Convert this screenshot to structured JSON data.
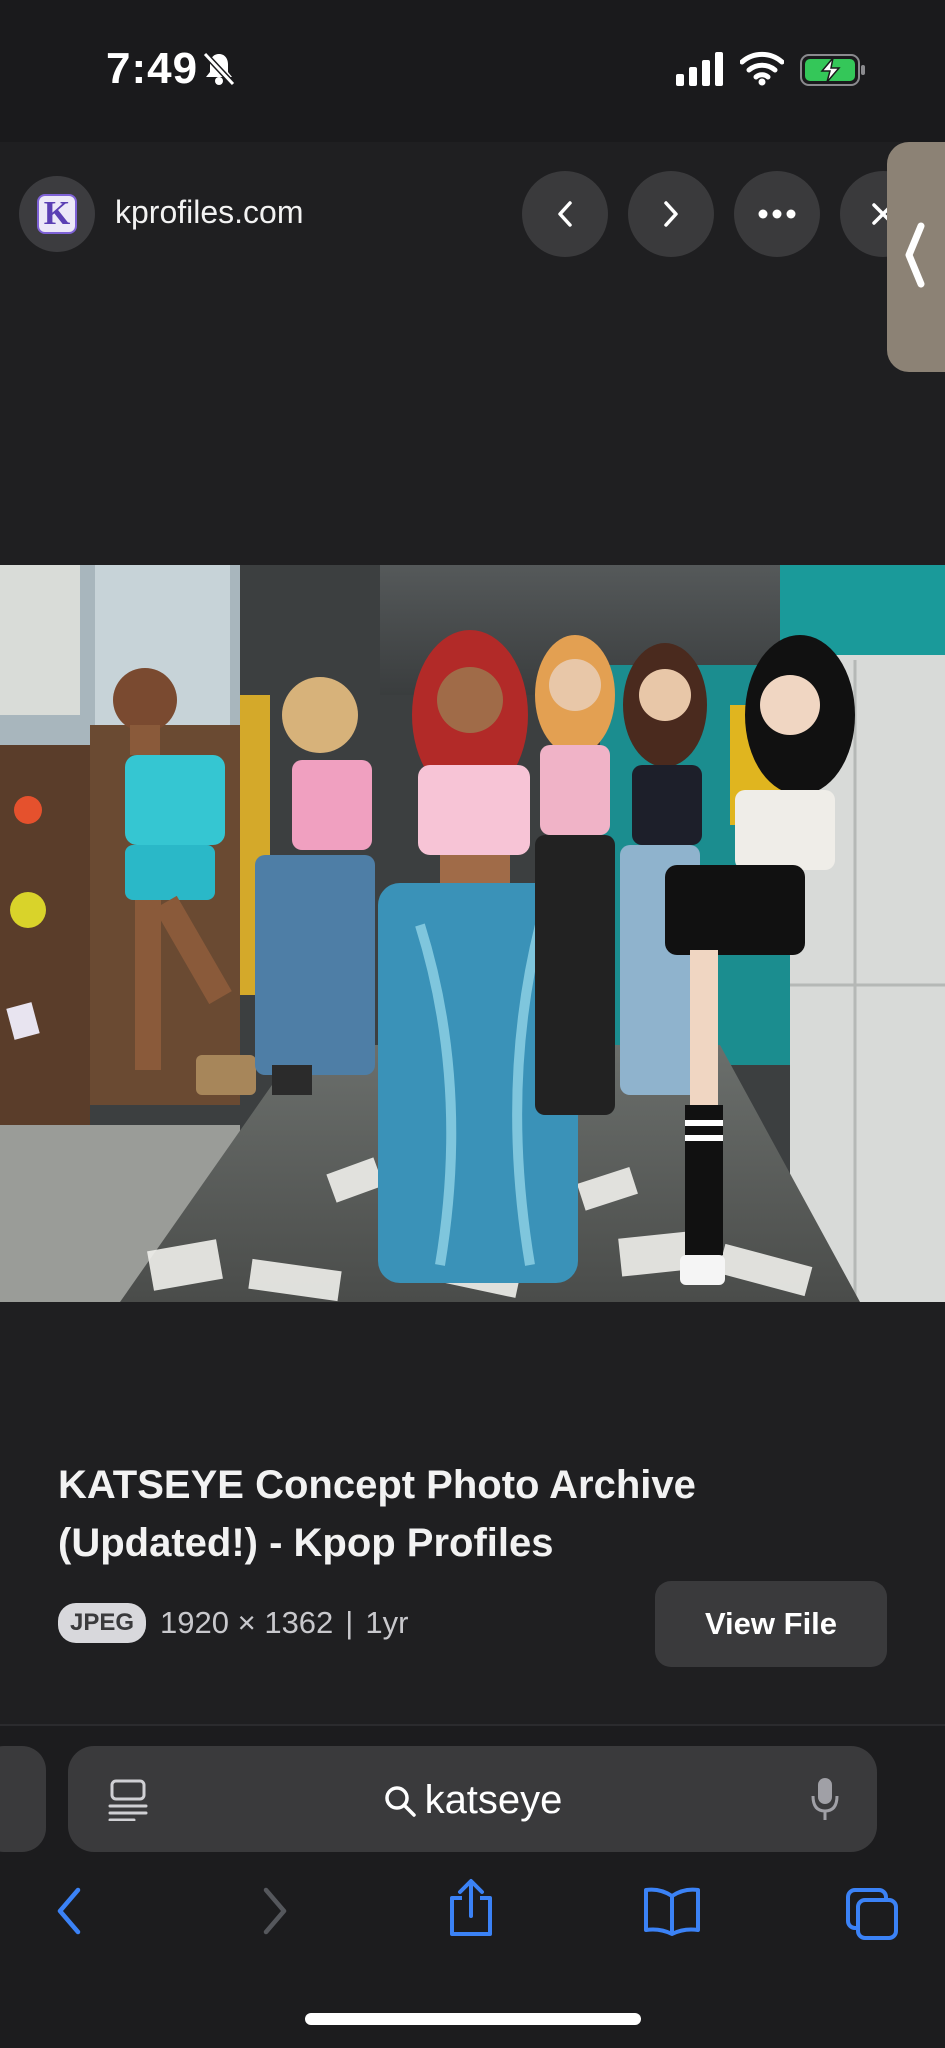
{
  "status_bar": {
    "time": "7:49"
  },
  "browser": {
    "site_initial": "K",
    "site_name": "kprofiles.com"
  },
  "result": {
    "title": "KATSEYE Concept Photo Archive (Updated!) - Kpop Profiles",
    "format_badge": "JPEG",
    "dimensions": "1920 × 1362",
    "separator": "|",
    "age": "1yr",
    "view_file_label": "View File"
  },
  "search": {
    "query": "katseye"
  },
  "colors": {
    "accent": "#3b82f6",
    "background": "#1f1f21",
    "button": "#3a3a3c"
  }
}
